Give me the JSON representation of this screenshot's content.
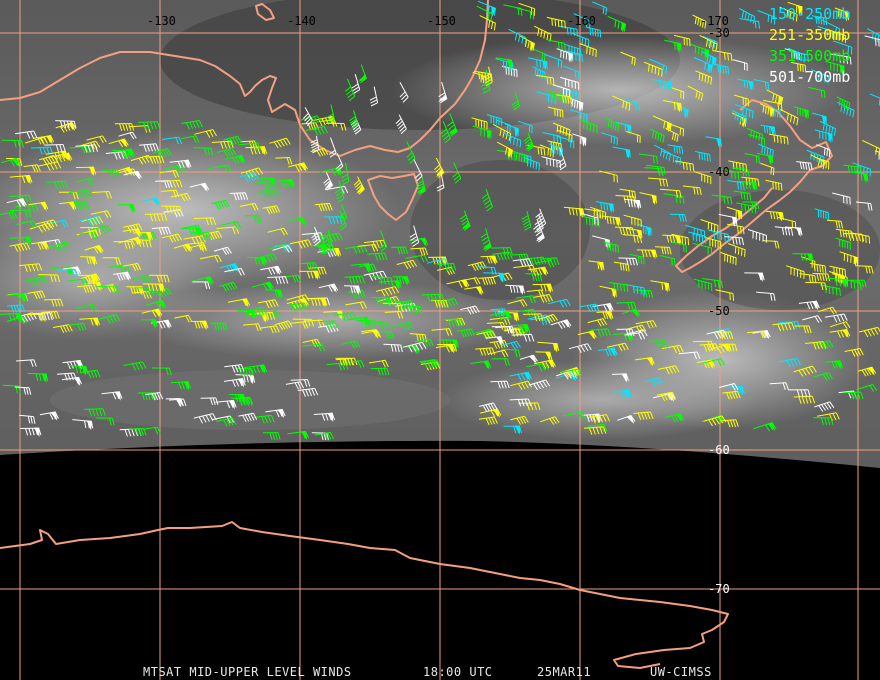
{
  "legend": [
    {
      "label": "150-250mb",
      "color": "#00e8ff"
    },
    {
      "label": "251-350mb",
      "color": "#ffff00"
    },
    {
      "label": "351-500mb",
      "color": "#00ff00"
    },
    {
      "label": "501-700mb",
      "color": "#ffffff"
    }
  ],
  "longitude_labels": [
    "-130",
    "-140",
    "-150",
    "-160",
    "-170"
  ],
  "latitude_labels": [
    "-30",
    "-40",
    "-50",
    "-60",
    "-70"
  ],
  "footer": {
    "product": "MTSAT MID-UPPER LEVEL WINDS",
    "time": "18:00 UTC",
    "date": "25MAR11",
    "source": "UW-CIMSS"
  },
  "colors": {
    "grid": "#f0a080",
    "coast": "#f4a080",
    "space": "#000000"
  }
}
